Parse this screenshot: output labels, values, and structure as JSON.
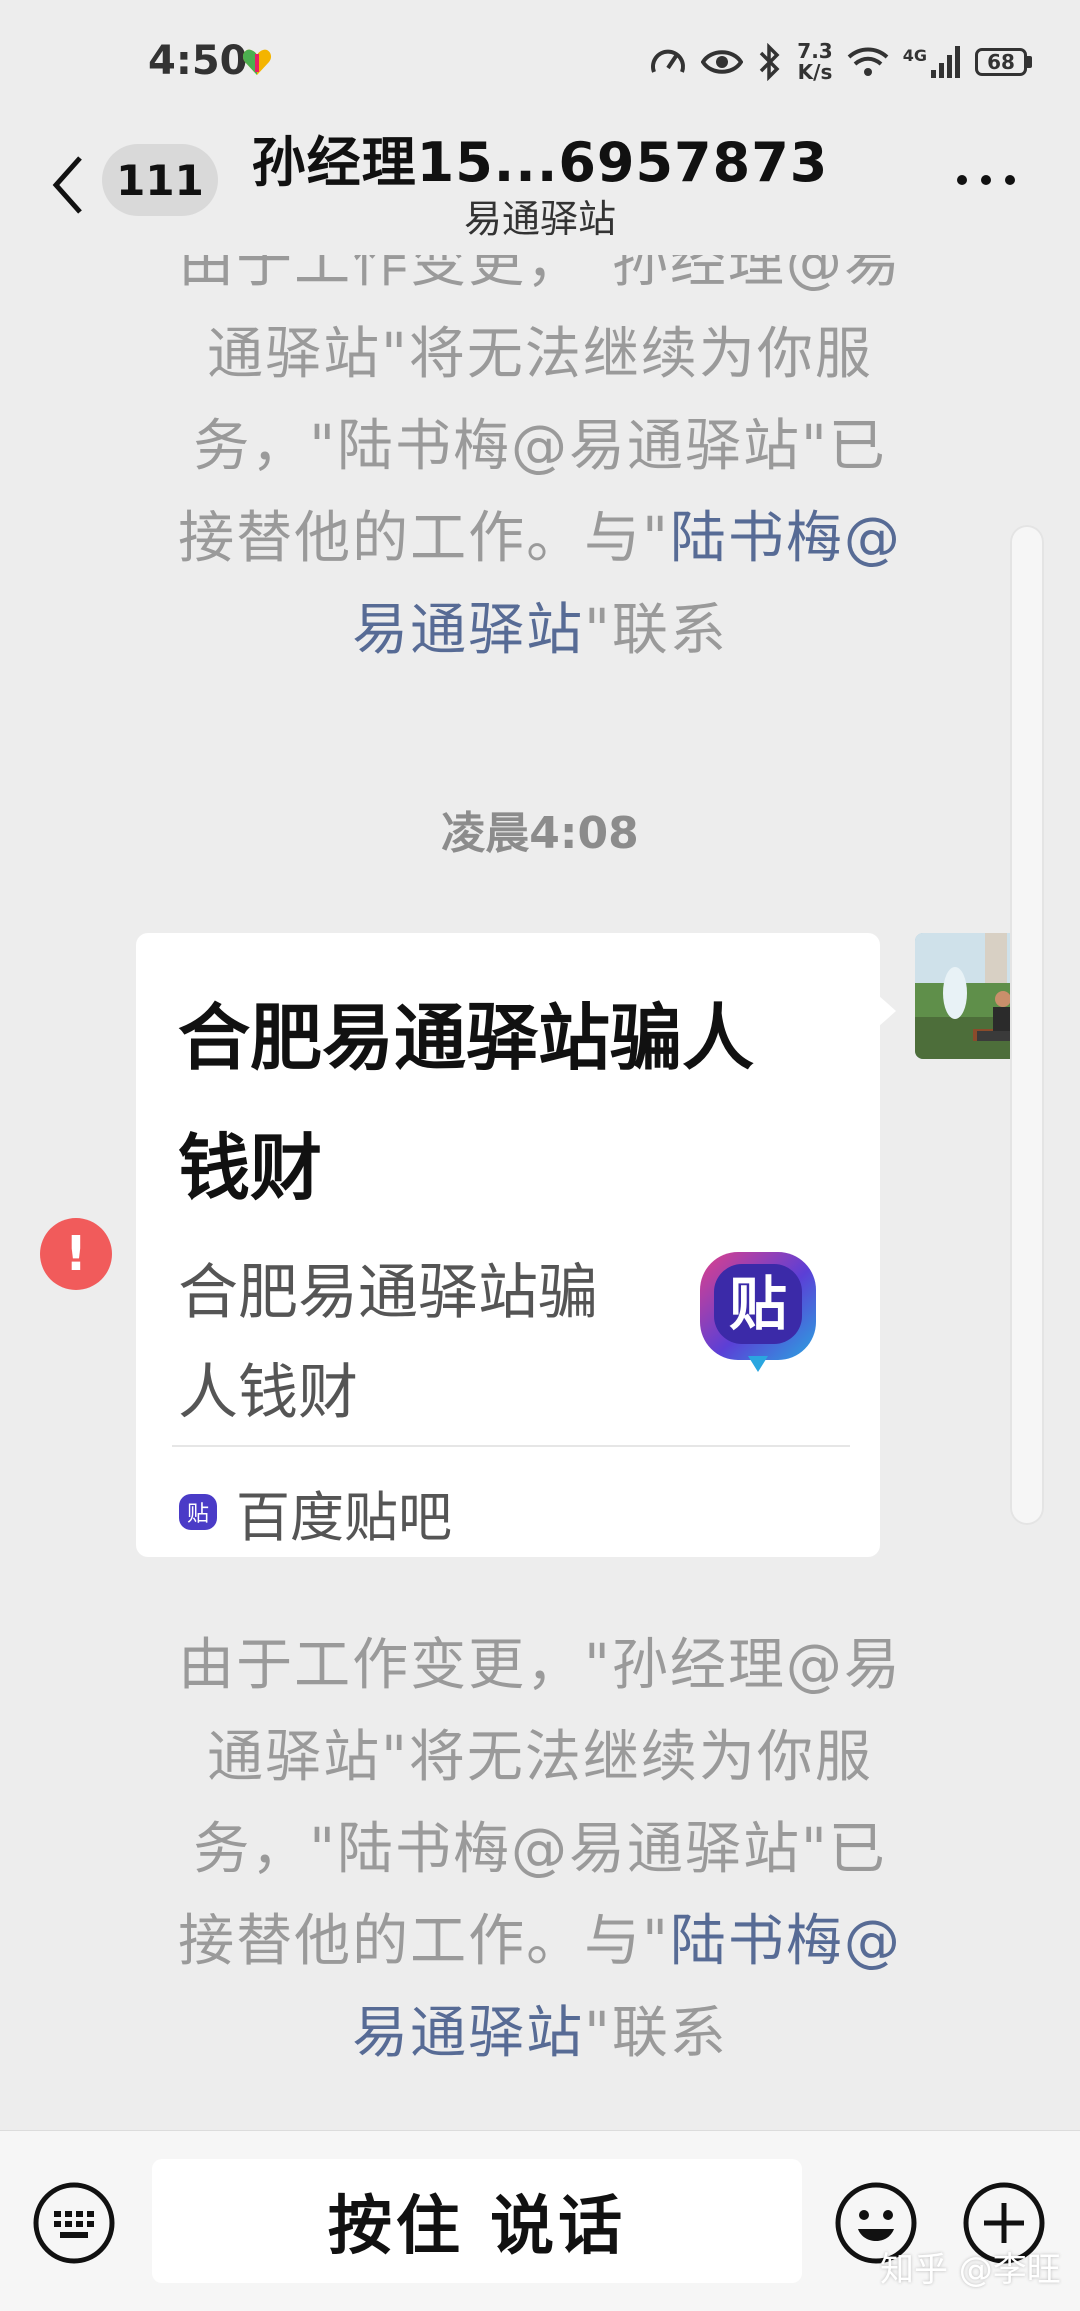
{
  "status_bar": {
    "time": "4:50",
    "speed_value": "7.3",
    "speed_unit": "K/s",
    "network": "4G",
    "battery": "68"
  },
  "header": {
    "unread_count": "111",
    "title": "孙经理15...6957873",
    "subtitle": "易通驿站"
  },
  "messages": {
    "system_top": {
      "line1": "由于工作变更，\"孙经理@易",
      "line2": "通驿站\"将无法继续为你服",
      "line3": "务，\"陆书梅@易通驿站\"已",
      "line4_prefix": "接替他的工作。与\"",
      "line4_link": "陆书梅@",
      "line5_link": "易通驿站",
      "line5_suffix": "\"联系"
    },
    "time_label": "凌晨4:08",
    "card": {
      "title": "合肥易通驿站骗人钱财",
      "description": "合肥易通驿站骗人钱财",
      "source": "百度贴吧",
      "thumb_glyph": "贴",
      "source_glyph": "贴"
    },
    "error_glyph": "!",
    "system_bottom": {
      "line1": "由于工作变更，\"孙经理@易",
      "line2": "通驿站\"将无法继续为你服",
      "line3": "务，\"陆书梅@易通驿站\"已",
      "line4_prefix": "接替他的工作。与\"",
      "line4_link": "陆书梅@",
      "line5_link": "易通驿站",
      "line5_suffix": "\"联系"
    }
  },
  "input_bar": {
    "talk_label": "按住 说话"
  },
  "watermark": "知乎 @李旺",
  "colors": {
    "link": "#576b95",
    "error": "#f15b5b",
    "background": "#ededed"
  }
}
